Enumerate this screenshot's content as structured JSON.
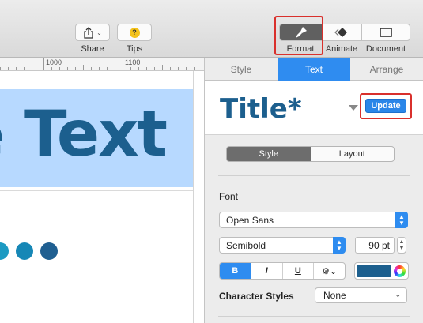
{
  "toolbar": {
    "share_label": "Share",
    "tips_label": "Tips",
    "tips_glyph": "?",
    "format_label": "Format",
    "animate_label": "Animate",
    "document_label": "Document"
  },
  "ruler": {
    "marks": [
      "1000",
      "1100"
    ]
  },
  "canvas": {
    "text": "e Text",
    "dot_colors": [
      "#1c9ac2",
      "#1687b6",
      "#1f5f91"
    ]
  },
  "inspector": {
    "tabs": [
      {
        "label": "Style",
        "active": false
      },
      {
        "label": "Text",
        "active": true
      },
      {
        "label": "Arrange",
        "active": false
      }
    ],
    "paragraph_style": "Title*",
    "update_label": "Update",
    "segments": [
      {
        "label": "Style",
        "active": true
      },
      {
        "label": "Layout",
        "active": false
      }
    ],
    "font_label": "Font",
    "font_family": "Open Sans",
    "font_weight": "Semibold",
    "font_size": "90 pt",
    "format_buttons": {
      "bold": "B",
      "italic": "I",
      "underline": "U",
      "gear": "⚙⌄"
    },
    "text_color": "#1c5f8e",
    "character_styles_label": "Character Styles",
    "character_styles_value": "None"
  },
  "colors": {
    "accent": "#2e8cf0",
    "highlight": "#d9302c",
    "title_blue": "#1c5f8e",
    "textbox_bg": "#b7d9ff"
  }
}
